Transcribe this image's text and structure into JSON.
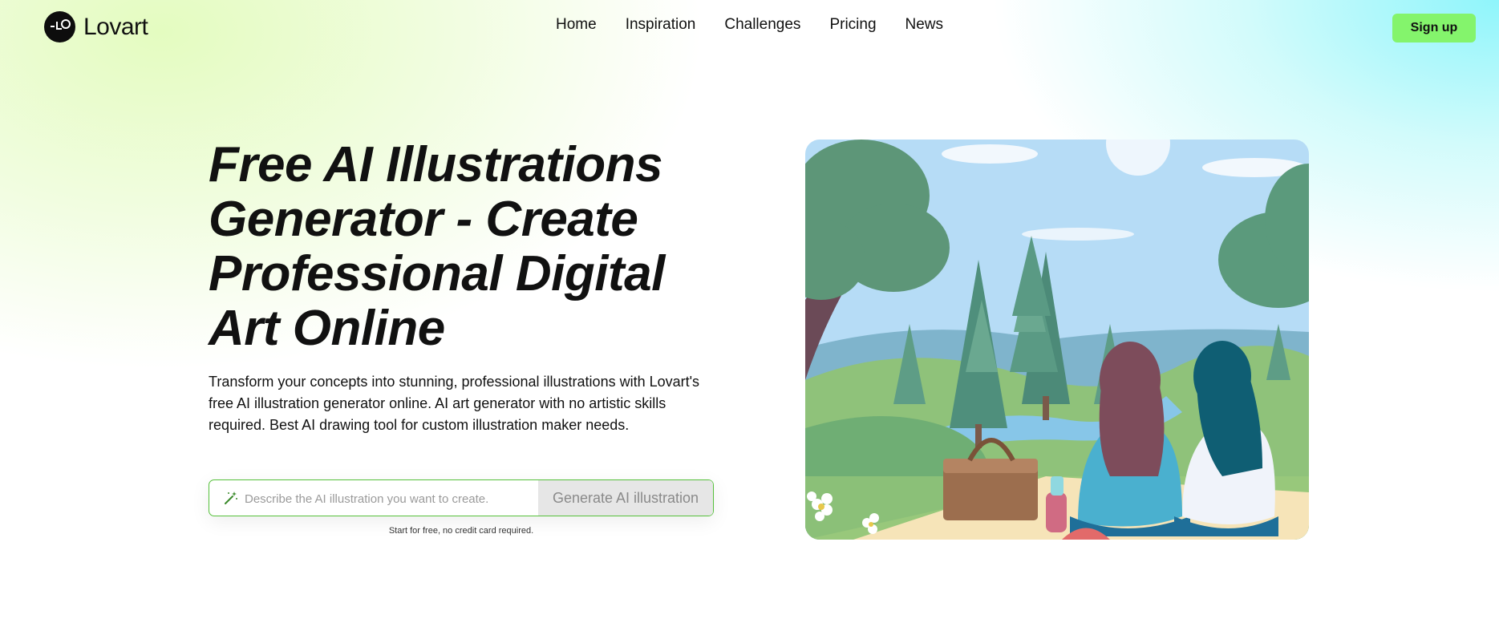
{
  "header": {
    "logo_text": "Lovart",
    "nav": [
      {
        "label": "Home"
      },
      {
        "label": "Inspiration"
      },
      {
        "label": "Challenges"
      },
      {
        "label": "Pricing"
      },
      {
        "label": "News"
      }
    ],
    "signup_label": "Sign up"
  },
  "hero": {
    "title": "Free AI Illustrations Generator - Create Professional Digital Art Online",
    "description": "Transform your concepts into stunning, professional illustrations with Lovart's free AI illustration generator online. AI art generator with no artistic skills required. Best AI drawing tool for custom illustration maker needs.",
    "prompt": {
      "placeholder": "Describe the AI illustration you want to create.",
      "value": "",
      "button_label": "Generate AI illustration",
      "icon": "magic-wand-icon"
    },
    "hint": "Start for free, no credit card required."
  },
  "illustration": {
    "subject": "two women picnic by a river with trees"
  },
  "colors": {
    "accent": "#84f46c",
    "input_border": "#56c13b",
    "text": "#111111"
  }
}
